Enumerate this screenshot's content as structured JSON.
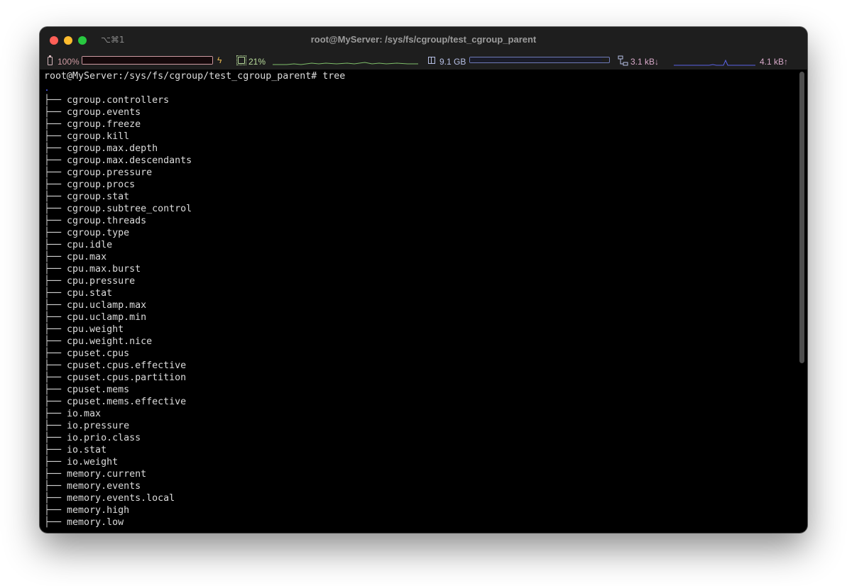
{
  "window": {
    "title": "root@MyServer: /sys/fs/cgroup/test_cgroup_parent",
    "shortcut": "⌥⌘1"
  },
  "status": {
    "battery": {
      "label": "100%",
      "level": 1.0,
      "charging_icon": "bolt-icon",
      "color": "#cf9aa2"
    },
    "cpu": {
      "label": "21%",
      "color": "#b9dd9c"
    },
    "memory": {
      "label": "9.1 GB",
      "level": 0.95,
      "color": "#b7c0e6"
    },
    "network": {
      "down_label": "3.1 kB↓",
      "up_label": "4.1 kB↑",
      "color": "#d6a8c8",
      "graph_color": "#5b63e6"
    }
  },
  "terminal": {
    "prompt": "root@MyServer:/sys/fs/cgroup/test_cgroup_parent# tree",
    "root": ".",
    "branch": "├── ",
    "entries": [
      "cgroup.controllers",
      "cgroup.events",
      "cgroup.freeze",
      "cgroup.kill",
      "cgroup.max.depth",
      "cgroup.max.descendants",
      "cgroup.pressure",
      "cgroup.procs",
      "cgroup.stat",
      "cgroup.subtree_control",
      "cgroup.threads",
      "cgroup.type",
      "cpu.idle",
      "cpu.max",
      "cpu.max.burst",
      "cpu.pressure",
      "cpu.stat",
      "cpu.uclamp.max",
      "cpu.uclamp.min",
      "cpu.weight",
      "cpu.weight.nice",
      "cpuset.cpus",
      "cpuset.cpus.effective",
      "cpuset.cpus.partition",
      "cpuset.mems",
      "cpuset.mems.effective",
      "io.max",
      "io.pressure",
      "io.prio.class",
      "io.stat",
      "io.weight",
      "memory.current",
      "memory.events",
      "memory.events.local",
      "memory.high",
      "memory.low"
    ]
  }
}
